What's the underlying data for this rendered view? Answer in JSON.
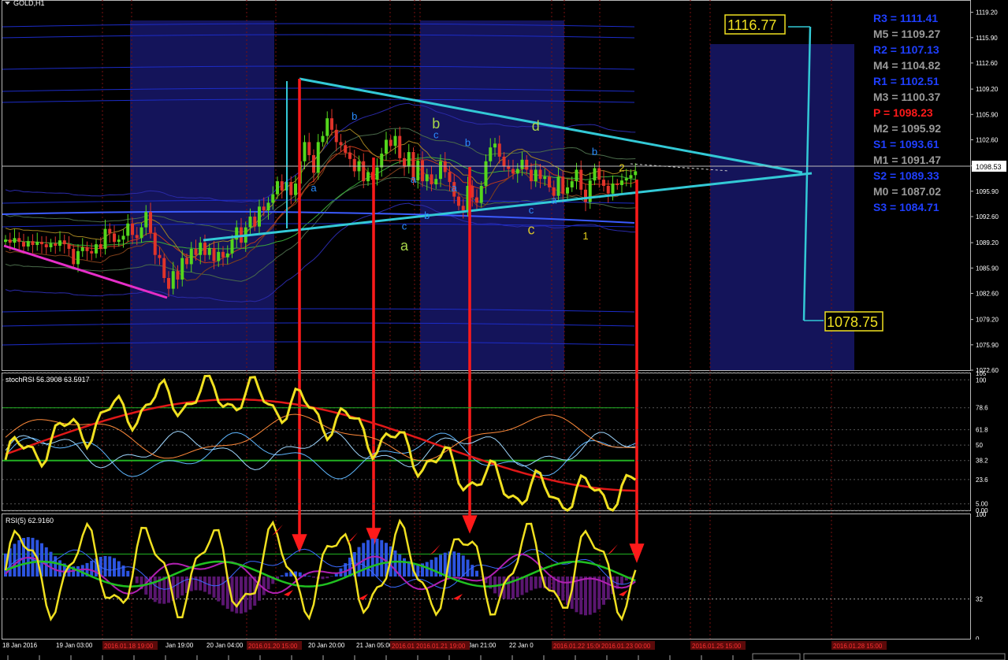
{
  "window": {
    "title": "GOLD,H1"
  },
  "main_panel": {
    "price_ticks": [
      "1119.20",
      "1115.90",
      "1112.60",
      "1109.20",
      "1105.90",
      "1102.60",
      "1099.20",
      "1095.90",
      "1092.60",
      "1089.20",
      "1085.90",
      "1082.60",
      "1079.20",
      "1075.90",
      "1072.60"
    ],
    "current_price": "1098.53",
    "target_high": "1116.77",
    "target_low": "1078.75",
    "pivots": [
      {
        "label": "R3 = 1111.41",
        "color": "#1f3fff"
      },
      {
        "label": "M5 = 1109.27",
        "color": "#9a9a9a"
      },
      {
        "label": "R2 = 1107.13",
        "color": "#1f3fff"
      },
      {
        "label": "M4 = 1104.82",
        "color": "#9a9a9a"
      },
      {
        "label": "R1 = 1102.51",
        "color": "#1f3fff"
      },
      {
        "label": "M3 = 1100.37",
        "color": "#9a9a9a"
      },
      {
        "label": "P  = 1098.23",
        "color": "#ff1a1a"
      },
      {
        "label": "M2 = 1095.92",
        "color": "#9a9a9a"
      },
      {
        "label": "S1 = 1093.61",
        "color": "#1f3fff"
      },
      {
        "label": "M1 = 1091.47",
        "color": "#9a9a9a"
      },
      {
        "label": "S2 = 1089.33",
        "color": "#1f3fff"
      },
      {
        "label": "M0 = 1087.02",
        "color": "#9a9a9a"
      },
      {
        "label": "S3 = 1084.71",
        "color": "#1f3fff"
      }
    ],
    "wave_labels": [
      {
        "text": "b",
        "price": 1105.2,
        "bar": 77,
        "color": "#2a8cff"
      },
      {
        "text": "a",
        "price": 1095.9,
        "bar": 68,
        "color": "#2a8cff"
      },
      {
        "text": "b",
        "price": 1104.1,
        "bar": 95,
        "color": "#a7d44a"
      },
      {
        "text": "c",
        "price": 1102.8,
        "bar": 95,
        "color": "#2a8cff"
      },
      {
        "text": "a",
        "price": 1097.0,
        "bar": 90,
        "color": "#2a8cff"
      },
      {
        "text": "a",
        "price": 1095.9,
        "bar": 99,
        "color": "#2a8cff"
      },
      {
        "text": "b",
        "price": 1101.8,
        "bar": 102,
        "color": "#2a8cff"
      },
      {
        "text": "c",
        "price": 1090.9,
        "bar": 88,
        "color": "#2a8cff"
      },
      {
        "text": "b",
        "price": 1092.3,
        "bar": 93,
        "color": "#2a8cff"
      },
      {
        "text": "a",
        "price": 1088.2,
        "bar": 88,
        "color": "#a7d44a"
      },
      {
        "text": "d",
        "price": 1103.8,
        "bar": 117,
        "color": "#a7d44a"
      },
      {
        "text": "c",
        "price": 1093.0,
        "bar": 116,
        "color": "#2a8cff"
      },
      {
        "text": "a",
        "price": 1094.3,
        "bar": 121,
        "color": "#2a8cff"
      },
      {
        "text": "c",
        "price": 1090.3,
        "bar": 116,
        "color": "#d4c02a"
      },
      {
        "text": "b",
        "price": 1100.6,
        "bar": 130,
        "color": "#2a8cff"
      },
      {
        "text": "2",
        "price": 1098.5,
        "bar": 136,
        "color": "#e8d21a"
      },
      {
        "text": "1",
        "price": 1089.6,
        "bar": 128,
        "color": "#e8d21a"
      }
    ]
  },
  "stoch_panel": {
    "label": "stochRSI 56.3908 63.5917",
    "ticks": [
      "105",
      "100",
      "78.6",
      "61.8",
      "50",
      "38.2",
      "23.6",
      "5.00",
      "0.00"
    ]
  },
  "rsi_panel": {
    "label": "RSI(5) 62.9160",
    "ticks": [
      "100",
      "32",
      "0"
    ]
  },
  "time_axis": {
    "labels": [
      {
        "text": "18 Jan 2016",
        "x": 0
      },
      {
        "text": "19 Jan 03:00",
        "x": 68
      },
      {
        "text": "Jan 19:00",
        "x": 207
      },
      {
        "text": "20 Jan 04:00",
        "x": 259
      },
      {
        "text": "20 Jan 20:00",
        "x": 388
      },
      {
        "text": "21 Jan 05:00",
        "x": 449
      },
      {
        "text": "21 Jan 21:00",
        "x": 580
      },
      {
        "text": "22 Jan 0",
        "x": 643
      }
    ],
    "red_dates": [
      {
        "text": "2016.01.18 19:00",
        "x": 130
      },
      {
        "text": "2016.01.20 15:00",
        "x": 313
      },
      {
        "text": "2016.01.21 00:00",
        "x": 495
      },
      {
        "text": "2016.01.21 19:00",
        "x": 526
      },
      {
        "text": "2016.01.22 15:00",
        "x": 700
      },
      {
        "text": "2016.01.23 00:00",
        "x": 761
      },
      {
        "text": "2016.01.25 15:00",
        "x": 876
      },
      {
        "text": "2016.01.28 15:00",
        "x": 1055
      }
    ]
  },
  "chart_data": {
    "type": "candlestick",
    "instrument": "GOLD",
    "timeframe": "H1",
    "y_range": [
      1072.6,
      1120.8
    ],
    "ohlc_close": [
      1089.6,
      1089.2,
      1089.8,
      1089.3,
      1088.7,
      1089.4,
      1088.9,
      1089.3,
      1089.0,
      1088.6,
      1089.1,
      1088.8,
      1089.5,
      1089.0,
      1088.4,
      1086.4,
      1088.1,
      1088.6,
      1088.1,
      1087.8,
      1089.0,
      1088.4,
      1091.0,
      1090.4,
      1089.3,
      1089.6,
      1090.1,
      1091.7,
      1090.2,
      1089.8,
      1091.2,
      1093.2,
      1090.5,
      1087.6,
      1087.2,
      1084.6,
      1083.2,
      1085.5,
      1084.4,
      1087.2,
      1086.4,
      1088.4,
      1087.6,
      1089.2,
      1087.6,
      1088.5,
      1086.8,
      1088.0,
      1087.3,
      1087.8,
      1089.6,
      1091.2,
      1089.2,
      1091.2,
      1092.6,
      1091.3,
      1093.9,
      1093.4,
      1094.4,
      1095.5,
      1097.2,
      1096.0,
      1097.1,
      1095.4,
      1096.9,
      1099.8,
      1102.3,
      1100.6,
      1098.3,
      1102.3,
      1103.1,
      1105.4,
      1103.9,
      1102.3,
      1101.9,
      1100.9,
      1100.1,
      1098.5,
      1099.8,
      1097.2,
      1098.4,
      1097.4,
      1099.0,
      1100.8,
      1102.6,
      1101.8,
      1103.1,
      1100.2,
      1099.1,
      1101.0,
      1097.3,
      1099.9,
      1097.2,
      1098.1,
      1096.8,
      1097.5,
      1099.8,
      1098.4,
      1097.1,
      1095.2,
      1094.0,
      1093.4,
      1096.6,
      1095.1,
      1094.4,
      1096.6,
      1099.8,
      1101.6,
      1102.1,
      1100.4,
      1099.1,
      1098.8,
      1098.2,
      1098.8,
      1100.0,
      1098.7,
      1097.2,
      1098.7,
      1097.5,
      1097.8,
      1096.4,
      1095.3,
      1097.8,
      1095.6,
      1096.4,
      1097.2,
      1098.7,
      1096.1,
      1094.5,
      1097.3,
      1098.9,
      1097.4,
      1096.6,
      1095.6,
      1096.9,
      1096.7,
      1097.3,
      1097.6,
      1098.0,
      1098.5
    ],
    "annotations": [
      "1116.77",
      "1078.75"
    ]
  }
}
